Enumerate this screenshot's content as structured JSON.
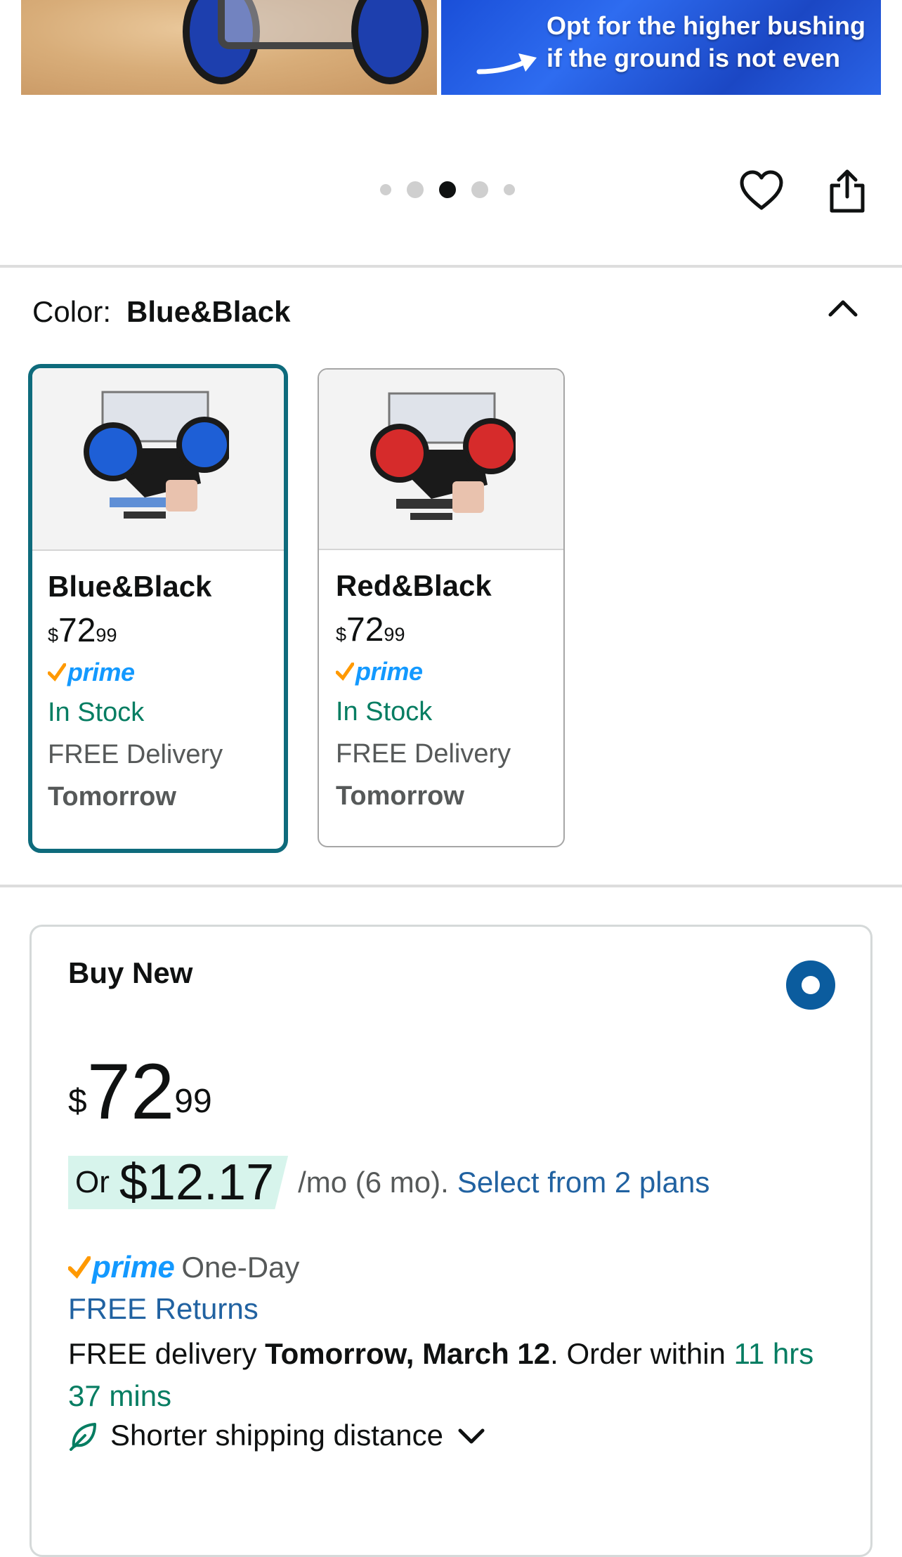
{
  "banner": {
    "line1": "Opt for the higher bushing",
    "line2": "if the ground is not even"
  },
  "carousel": {
    "dot_count": 5,
    "active_index": 2
  },
  "color": {
    "label": "Color:",
    "selected": "Blue&Black",
    "options": [
      {
        "name": "Blue&Black",
        "currency": "$",
        "price_whole": "72",
        "price_fraction": "99",
        "prime": "prime",
        "stock": "In Stock",
        "delivery": "FREE Delivery",
        "delivery_day": "Tomorrow",
        "wheel_color": "#1e5fd6"
      },
      {
        "name": "Red&Black",
        "currency": "$",
        "price_whole": "72",
        "price_fraction": "99",
        "prime": "prime",
        "stock": "In Stock",
        "delivery": "FREE Delivery",
        "delivery_day": "Tomorrow",
        "wheel_color": "#d62b2b"
      }
    ]
  },
  "buy": {
    "title": "Buy New",
    "currency": "$",
    "price_whole": "72",
    "price_fraction": "99",
    "or_label": "Or",
    "monthly_amount": "$12.17",
    "monthly_terms": "/mo (6 mo).",
    "plans_link": "Select from 2 plans",
    "prime": "prime",
    "prime_speed": "One-Day",
    "returns": "FREE Returns",
    "delivery_prefix": "FREE delivery",
    "delivery_date": "Tomorrow, March 12",
    "delivery_mid": ". Order within",
    "delivery_countdown": "11 hrs 37 mins",
    "shipping_note": "Shorter shipping distance"
  },
  "colors": {
    "selected_border": "#0e6b7c",
    "prime_blue": "#1399ff",
    "prime_check": "#ff9900",
    "in_stock_green": "#067d62",
    "link_blue": "#2162a1",
    "radio_blue": "#0b5c9e"
  }
}
